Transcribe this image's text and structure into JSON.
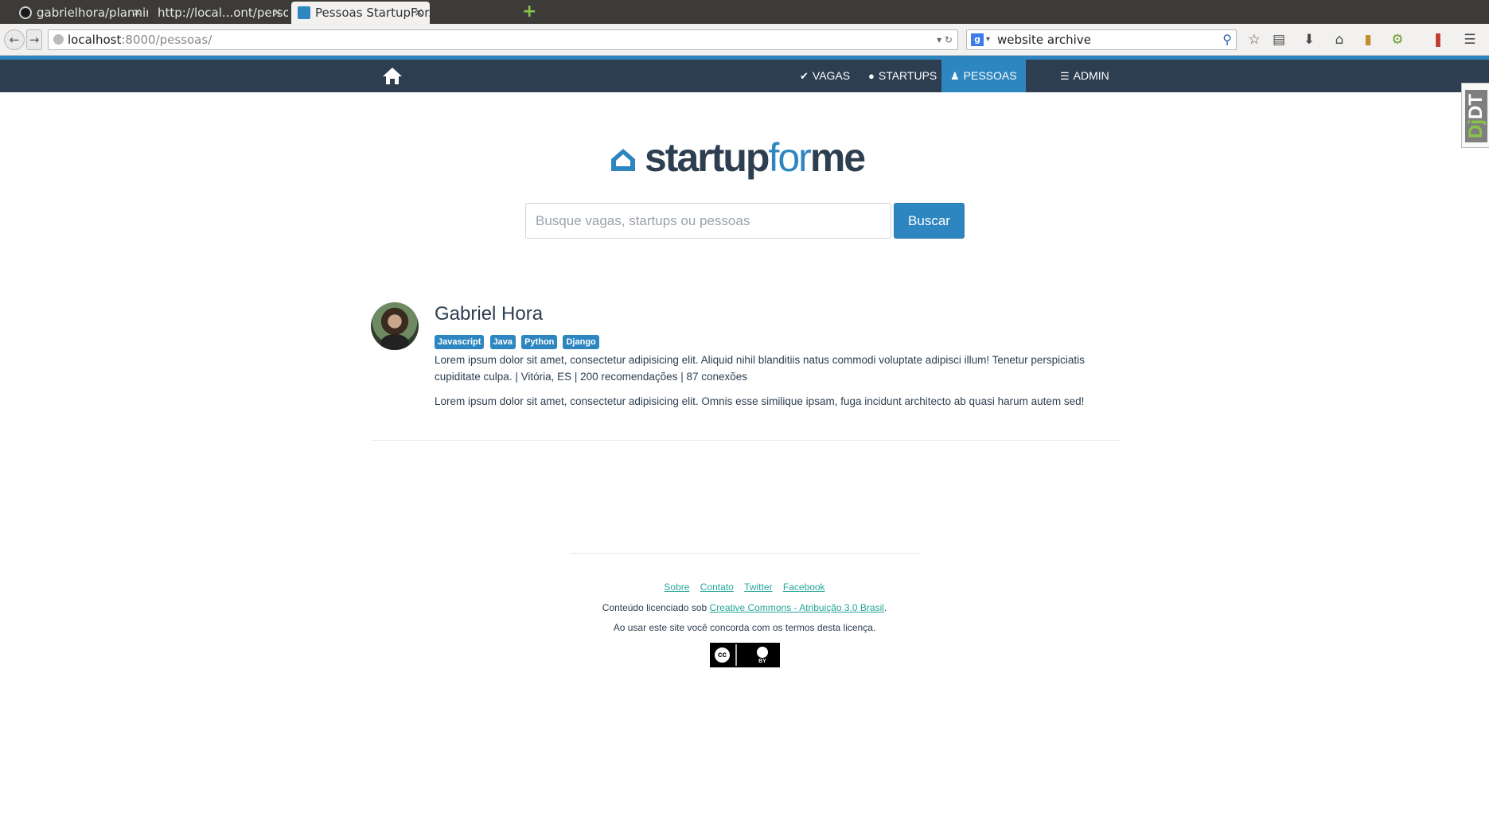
{
  "browser": {
    "tabs": [
      {
        "title": "gabrielhora/plannin..."
      },
      {
        "title": "http://local...ont/person/"
      },
      {
        "title": "Pessoas StartupFor..."
      }
    ],
    "close_glyph": "×",
    "new_tab_glyph": "+",
    "url_host": "localhost",
    "url_path": ":8000/pessoas/",
    "search_value": "website archive",
    "search_engine_letter": "g"
  },
  "site": {
    "nav": {
      "vagas": "VAGAS",
      "startups": "STARTUPS",
      "pessoas": "PESSOAS",
      "admin": "ADMIN"
    },
    "logo": {
      "part1": "startup",
      "part2": "for",
      "part3": "me"
    },
    "search": {
      "placeholder": "Busque vagas, startups ou pessoas",
      "button": "Buscar"
    },
    "accent_color": "#2e86c1",
    "nav_color": "#2c3e50"
  },
  "person": {
    "name": "Gabriel Hora",
    "tags": [
      "Javascript",
      "Java",
      "Python",
      "Django"
    ],
    "bio": "Lorem ipsum dolor sit amet, consectetur adipisicing elit. Aliquid nihil blanditiis natus commodi voluptate adipisci illum! Tenetur perspiciatis cupiditate culpa. | Vitória, ES | 200 recomendações | 87 conexões",
    "bio2": "Lorem ipsum dolor sit amet, consectetur adipisicing elit. Omnis esse similique ipsam, fuga incidunt architecto ab quasi harum autem sed!"
  },
  "footer": {
    "links": [
      "Sobre",
      "Contato",
      "Twitter",
      "Facebook"
    ],
    "license_prefix": "Conteúdo licenciado sob ",
    "license_link": "Creative Commons - Atribuição 3.0 Brasil",
    "license_suffix": ".",
    "agree": "Ao usar este site você concorda com os termos desta licença.",
    "cc_label": "cc",
    "cc_by_label": "BY"
  },
  "djdt": {
    "dj": "Dj",
    "dt": "DT"
  }
}
